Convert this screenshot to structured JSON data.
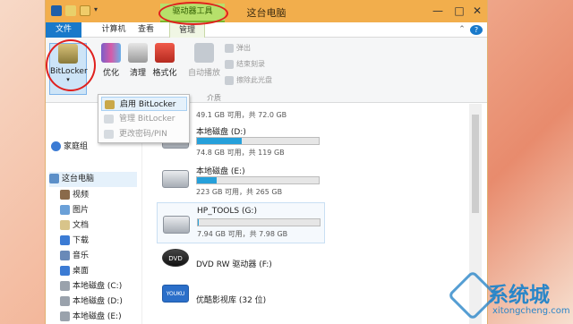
{
  "window": {
    "title": "这台电脑",
    "context_tab": "驱动器工具",
    "controls": {
      "minimize": "—",
      "maximize": "□",
      "close": "✕"
    }
  },
  "tabs": [
    {
      "label": "文件"
    },
    {
      "label": "计算机"
    },
    {
      "label": "查看"
    },
    {
      "label": "管理"
    }
  ],
  "ribbon": {
    "bitlocker_label": "BitLocker",
    "optimize_label": "优化",
    "cleanup_label": "清理",
    "format_label": "格式化",
    "autoplay_label": "自动播放",
    "eject_label": "弹出",
    "finish_burn_label": "结束刻录",
    "erase_disc_label": "擦除此光盘",
    "media_group_label": "介质",
    "collapse_label": "⌃",
    "help_label": "?"
  },
  "bitlocker_menu": {
    "items": [
      {
        "label": "启用 BitLocker",
        "enabled": true
      },
      {
        "label": "管理 BitLocker",
        "enabled": false
      },
      {
        "label": "更改密码/PIN",
        "enabled": false
      }
    ]
  },
  "sidebar": {
    "homegroup_label": "家庭组",
    "computer_label": "这台电脑",
    "items": [
      {
        "label": "视频"
      },
      {
        "label": "图片"
      },
      {
        "label": "文档"
      },
      {
        "label": "下载"
      },
      {
        "label": "音乐"
      },
      {
        "label": "桌面"
      },
      {
        "label": "本地磁盘 (C:)"
      },
      {
        "label": "本地磁盘 (D:)"
      },
      {
        "label": "本地磁盘 (E:)"
      }
    ]
  },
  "drives": [
    {
      "name": "",
      "info": "49.1 GB 可用，共 72.0 GB",
      "used": 0.32
    },
    {
      "name": "本地磁盘 (D:)",
      "info": "74.8 GB 可用，共 119 GB",
      "used": 0.37
    },
    {
      "name": "本地磁盘 (E:)",
      "info": "223 GB 可用，共 265 GB",
      "used": 0.16
    },
    {
      "name": "HP_TOOLS (G:)",
      "info": "7.94 GB 可用，共 7.98 GB",
      "used": 0.01
    },
    {
      "name": "DVD RW 驱动器 (F:)",
      "info": ""
    },
    {
      "name": "优酷影视库 (32 位)",
      "info": ""
    }
  ],
  "watermark": {
    "text": "系统城",
    "url": "xitongcheng.com"
  },
  "colors": {
    "title_bar": "#f2ae4c",
    "file_tab": "#1979ca",
    "context_tab": "#b6e06b",
    "drive_fill": "#26a0da",
    "highlight_circle": "#e0201e"
  }
}
